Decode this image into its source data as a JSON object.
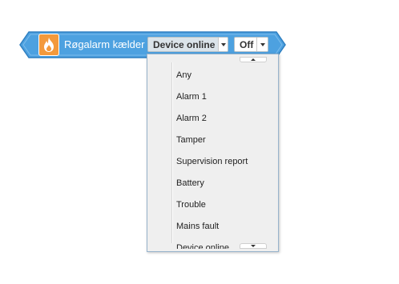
{
  "block": {
    "label": "Røgalarm kælder",
    "icon": "flame-icon",
    "colors": {
      "block": "#4da1e0",
      "block_border": "#2f7fc0",
      "icon_tile": "#f3993b"
    }
  },
  "status_dropdown": {
    "selected": "Device online"
  },
  "filter_dropdown": {
    "selected": "Off"
  },
  "menu": {
    "items": [
      "Any",
      "Alarm 1",
      "Alarm 2",
      "Tamper",
      "Supervision report",
      "Battery",
      "Trouble",
      "Mains fault",
      "Device online"
    ]
  }
}
